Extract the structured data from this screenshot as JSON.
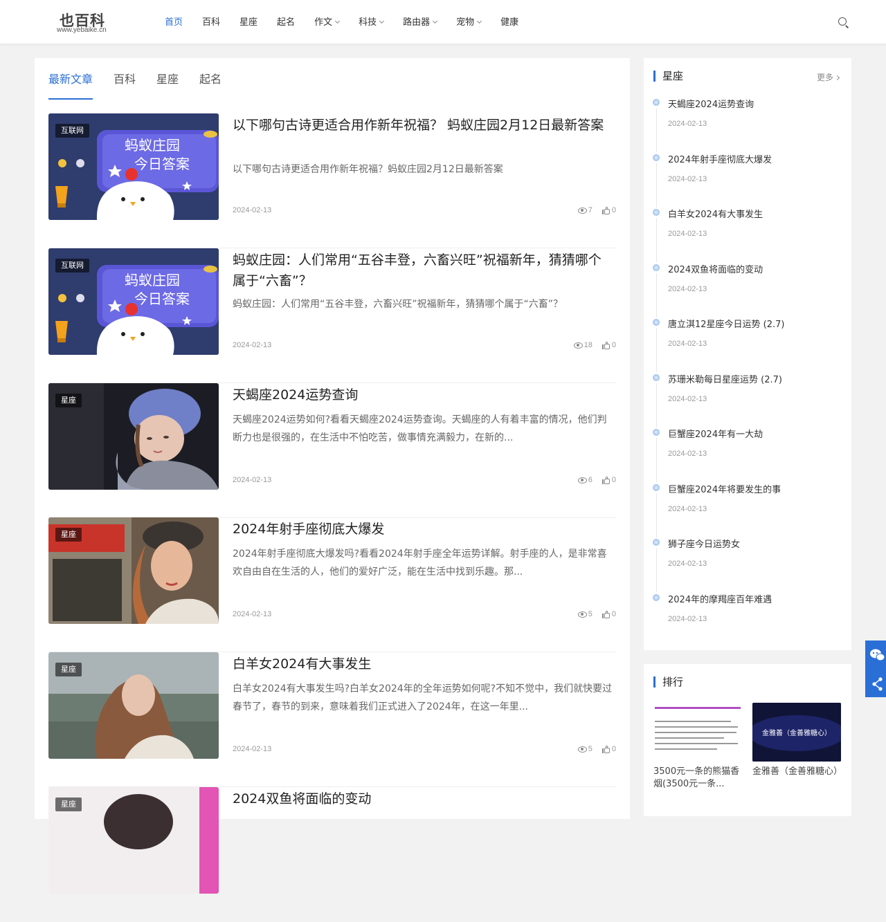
{
  "site": {
    "logo_main": "也百科",
    "logo_sub": "www.yebaike.cn"
  },
  "nav": [
    {
      "label": "首页",
      "active": true,
      "dropdown": false
    },
    {
      "label": "百科",
      "active": false,
      "dropdown": false
    },
    {
      "label": "星座",
      "active": false,
      "dropdown": false
    },
    {
      "label": "起名",
      "active": false,
      "dropdown": false
    },
    {
      "label": "作文",
      "active": false,
      "dropdown": true
    },
    {
      "label": "科技",
      "active": false,
      "dropdown": true
    },
    {
      "label": "路由器",
      "active": false,
      "dropdown": true
    },
    {
      "label": "宠物",
      "active": false,
      "dropdown": true
    },
    {
      "label": "健康",
      "active": false,
      "dropdown": false
    }
  ],
  "tabs": [
    {
      "label": "最新文章",
      "active": true
    },
    {
      "label": "百科",
      "active": false
    },
    {
      "label": "星座",
      "active": false
    },
    {
      "label": "起名",
      "active": false
    }
  ],
  "posts": [
    {
      "category": "互联网",
      "title": "以下哪句古诗更适合用作新年祝福？ 蚂蚁庄园2月12日最新答案",
      "excerpt": "以下哪句古诗更适合用作新年祝福？蚂蚁庄园2月12日最新答案",
      "date": "2024-02-13",
      "views": "7",
      "likes": "0",
      "thumb_text_1": "蚂蚁庄园",
      "thumb_text_2": "今日答案"
    },
    {
      "category": "互联网",
      "title": "蚂蚁庄园：人们常用“五谷丰登，六畜兴旺”祝福新年，猜猜哪个属于“六畜”？",
      "excerpt": "蚂蚁庄园：人们常用“五谷丰登，六畜兴旺”祝福新年，猜猜哪个属于“六畜”？",
      "date": "2024-02-13",
      "views": "18",
      "likes": "0",
      "thumb_text_1": "蚂蚁庄园",
      "thumb_text_2": "今日答案"
    },
    {
      "category": "星座",
      "title": "天蝎座2024运势查询",
      "excerpt": "天蝎座2024运势如何?看看天蝎座2024运势查询。天蝎座的人有着丰富的情况，他们判断力也是很强的，在生活中不怕吃苦，做事情充满毅力，在新的...",
      "date": "2024-02-13",
      "views": "6",
      "likes": "0"
    },
    {
      "category": "星座",
      "title": "2024年射手座彻底大爆发",
      "excerpt": "2024年射手座彻底大爆发吗?看看2024年射手座全年运势详解。射手座的人，是非常喜欢自由自在生活的人，他们的爱好广泛，能在生活中找到乐趣。那...",
      "date": "2024-02-13",
      "views": "5",
      "likes": "0"
    },
    {
      "category": "星座",
      "title": "白羊女2024有大事发生",
      "excerpt": "白羊女2024有大事发生吗?白羊女2024年的全年运势如何呢?不知不觉中，我们就快要过春节了，春节的到来，意味着我们正式进入了2024年，在这一年里...",
      "date": "2024-02-13",
      "views": "5",
      "likes": "0"
    },
    {
      "category": "星座",
      "title": "2024双鱼将面临的变动",
      "excerpt": "",
      "date": "",
      "views": "",
      "likes": ""
    }
  ],
  "sidebar": {
    "title": "星座",
    "more_label": "更多",
    "items": [
      {
        "title": "天蝎座2024运势查询",
        "date": "2024-02-13"
      },
      {
        "title": "2024年射手座彻底大爆发",
        "date": "2024-02-13"
      },
      {
        "title": "白羊女2024有大事发生",
        "date": "2024-02-13"
      },
      {
        "title": "2024双鱼将面临的变动",
        "date": "2024-02-13"
      },
      {
        "title": "唐立淇12星座今日运势 (2.7)",
        "date": "2024-02-13"
      },
      {
        "title": "苏珊米勒每日星座运势 (2.7)",
        "date": "2024-02-13"
      },
      {
        "title": "巨蟹座2024年有一大劫",
        "date": "2024-02-13"
      },
      {
        "title": "巨蟹座2024年将要发生的事",
        "date": "2024-02-13"
      },
      {
        "title": "狮子座今日运势女",
        "date": "2024-02-13"
      },
      {
        "title": "2024年的摩羯座百年难遇",
        "date": "2024-02-13"
      }
    ]
  },
  "ranking": {
    "title": "排行",
    "items": [
      {
        "caption": "3500元一条的熊猫香烟(3500元一条..."
      },
      {
        "caption": "金雅善（金善雅糖心）",
        "image_text": "金雅善（金善雅糖心）"
      }
    ]
  },
  "colors": {
    "accent": "#2a6fd6"
  },
  "icons": {
    "search": "search-icon",
    "wechat": "wechat-icon",
    "share": "share-icon",
    "views": "eye-icon",
    "likes": "thumbs-up-icon"
  }
}
